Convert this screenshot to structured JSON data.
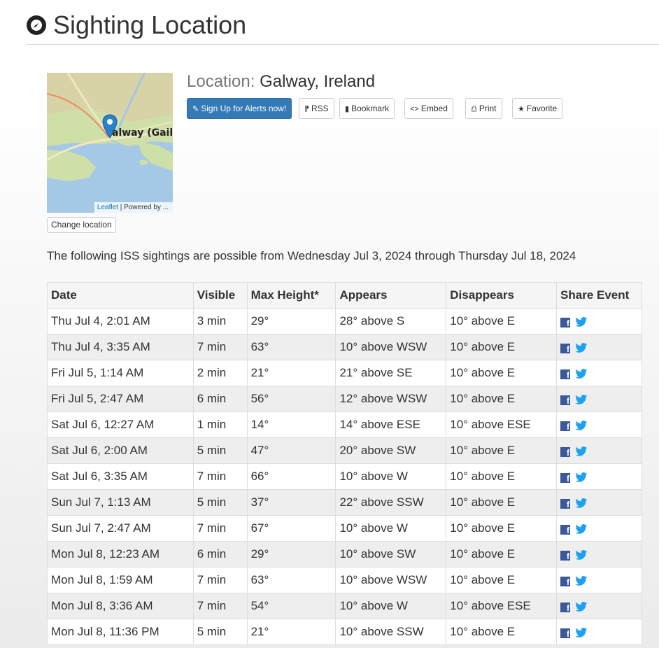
{
  "page": {
    "title": "Sighting Location"
  },
  "map": {
    "place_label": "alway (Gail",
    "attribution_link": "Leaflet",
    "attribution_rest": " | Powered by ..."
  },
  "change_location_label": "Change location",
  "location": {
    "label": "Location:",
    "value": "Galway, Ireland"
  },
  "toolbar": {
    "alerts": "Sign Up for Alerts now!",
    "rss": "RSS",
    "bookmark": "Bookmark",
    "embed": "Embed",
    "print": "Print",
    "favorite": "Favorite"
  },
  "intro": "The following ISS sightings are possible from Wednesday Jul 3, 2024 through Thursday Jul 18, 2024",
  "table": {
    "headers": [
      "Date",
      "Visible",
      "Max Height*",
      "Appears",
      "Disappears",
      "Share Event"
    ],
    "rows": [
      [
        "Thu Jul 4, 2:01 AM",
        "3 min",
        "29°",
        "28° above S",
        "10° above E"
      ],
      [
        "Thu Jul 4, 3:35 AM",
        "7 min",
        "63°",
        "10° above WSW",
        "10° above E"
      ],
      [
        "Fri Jul 5, 1:14 AM",
        "2 min",
        "21°",
        "21° above SE",
        "10° above E"
      ],
      [
        "Fri Jul 5, 2:47 AM",
        "6 min",
        "56°",
        "12° above WSW",
        "10° above E"
      ],
      [
        "Sat Jul 6, 12:27 AM",
        "1 min",
        "14°",
        "14° above ESE",
        "10° above ESE"
      ],
      [
        "Sat Jul 6, 2:00 AM",
        "5 min",
        "47°",
        "20° above SW",
        "10° above E"
      ],
      [
        "Sat Jul 6, 3:35 AM",
        "7 min",
        "66°",
        "10° above W",
        "10° above E"
      ],
      [
        "Sun Jul 7, 1:13 AM",
        "5 min",
        "37°",
        "22° above SSW",
        "10° above E"
      ],
      [
        "Sun Jul 7, 2:47 AM",
        "7 min",
        "67°",
        "10° above W",
        "10° above E"
      ],
      [
        "Mon Jul 8, 12:23 AM",
        "6 min",
        "29°",
        "10° above SW",
        "10° above E"
      ],
      [
        "Mon Jul 8, 1:59 AM",
        "7 min",
        "63°",
        "10° above WSW",
        "10° above E"
      ],
      [
        "Mon Jul 8, 3:36 AM",
        "7 min",
        "54°",
        "10° above W",
        "10° above ESE"
      ],
      [
        "Mon Jul 8, 11:36 PM",
        "5 min",
        "21°",
        "10° above SSW",
        "10° above E"
      ]
    ]
  },
  "colors": {
    "primary": "#337ab7",
    "facebook": "#3b5998",
    "twitter": "#1da1f2",
    "map_pin": "#2a81cb",
    "water": "#a5c8e6"
  }
}
